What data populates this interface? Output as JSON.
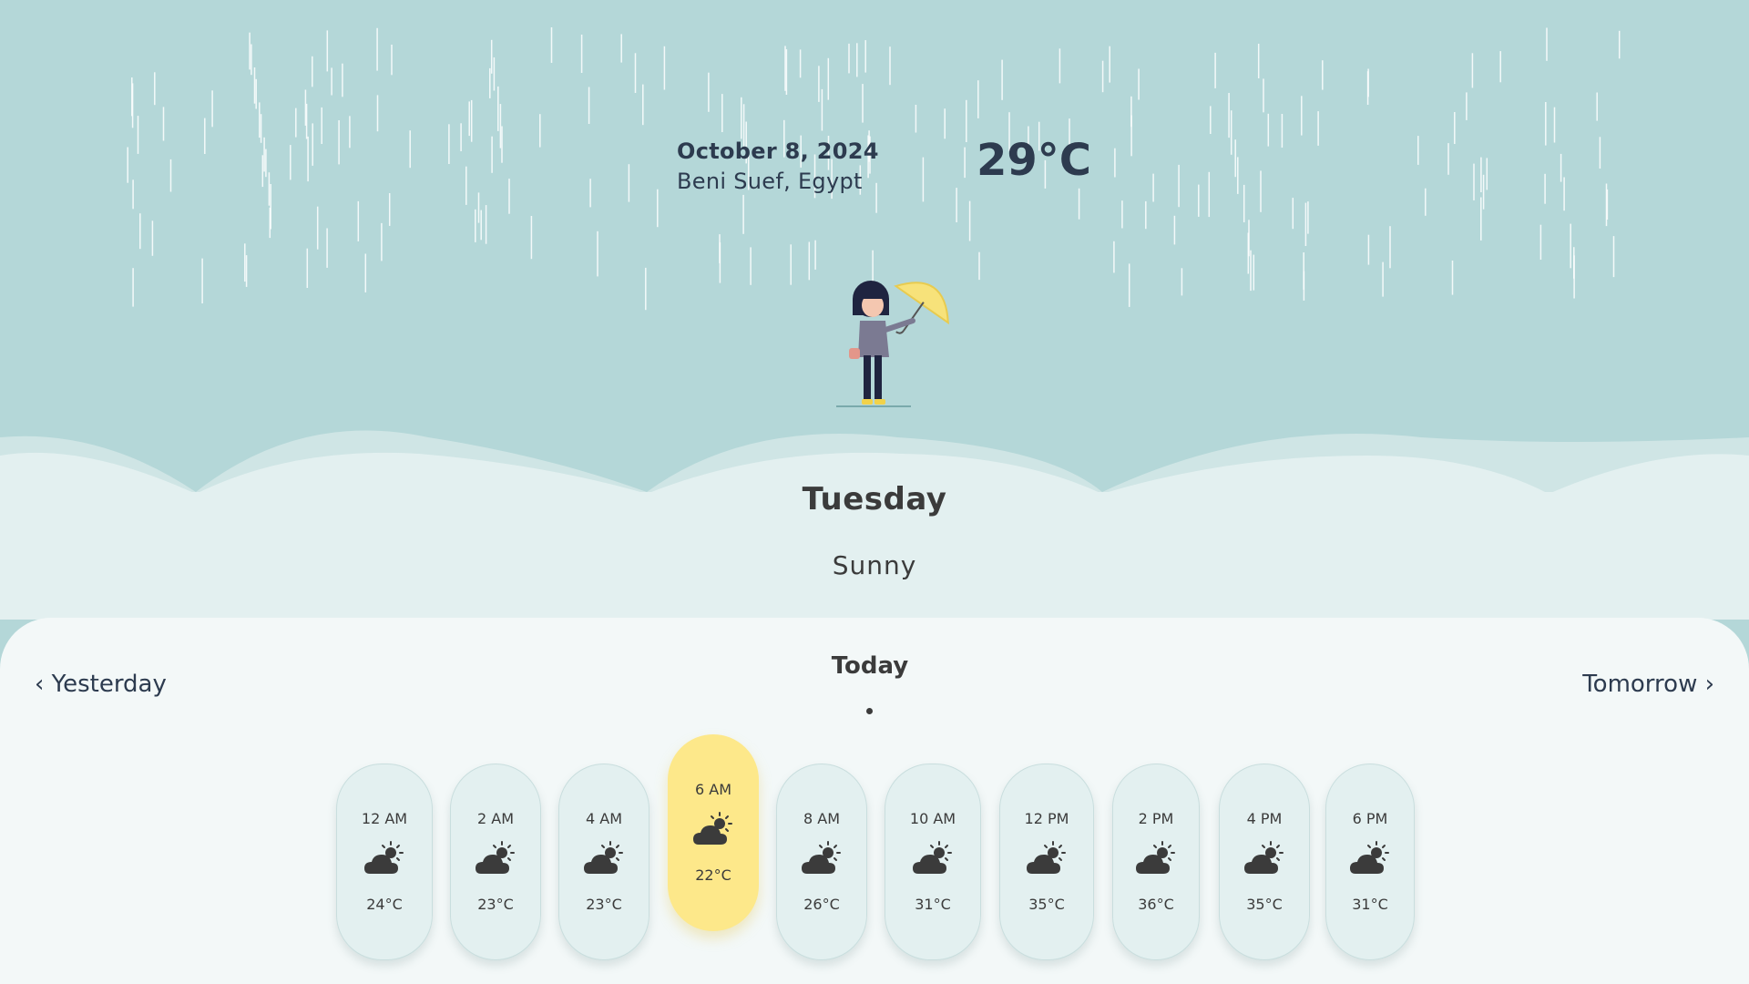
{
  "header": {
    "date": "October 8, 2024",
    "location": "Beni Suef, Egypt",
    "temperature": "29°C"
  },
  "day": {
    "name": "Tuesday",
    "condition": "Sunny"
  },
  "navigation": {
    "prev_label": "‹ Yesterday",
    "current_label": "Today",
    "next_label": "Tomorrow ›"
  },
  "hourly": [
    {
      "time": "12 AM",
      "temp": "24°C",
      "icon": "partly-cloudy-icon"
    },
    {
      "time": "2 AM",
      "temp": "23°C",
      "icon": "partly-cloudy-icon"
    },
    {
      "time": "4 AM",
      "temp": "23°C",
      "icon": "partly-cloudy-icon"
    },
    {
      "time": "6 AM",
      "temp": "22°C",
      "icon": "partly-cloudy-icon",
      "active": true
    },
    {
      "time": "8 AM",
      "temp": "26°C",
      "icon": "partly-cloudy-icon"
    },
    {
      "time": "10 AM",
      "temp": "31°C",
      "icon": "partly-cloudy-icon"
    },
    {
      "time": "12 PM",
      "temp": "35°C",
      "icon": "partly-cloudy-icon"
    },
    {
      "time": "2 PM",
      "temp": "36°C",
      "icon": "partly-cloudy-icon"
    },
    {
      "time": "4 PM",
      "temp": "35°C",
      "icon": "partly-cloudy-icon"
    },
    {
      "time": "6 PM",
      "temp": "31°C",
      "icon": "partly-cloudy-icon"
    }
  ],
  "colors": {
    "sky": "#b4d7d8",
    "panel": "#e3f0f0",
    "active_card": "#fde88a",
    "text": "#2d3b4f"
  }
}
